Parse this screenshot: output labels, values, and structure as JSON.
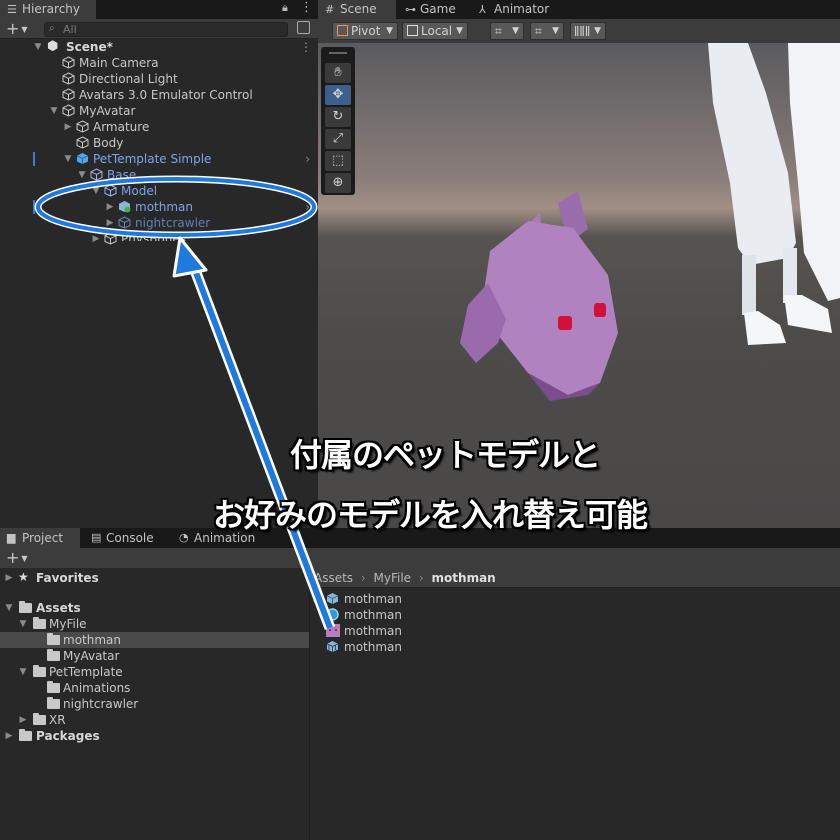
{
  "hierarchy": {
    "tab_label": "Hierarchy",
    "search_placeholder": "All",
    "items": [
      {
        "label": "Scene*"
      },
      {
        "label": "Main Camera"
      },
      {
        "label": "Directional Light"
      },
      {
        "label": "Avatars 3.0 Emulator Control"
      },
      {
        "label": "MyAvatar"
      },
      {
        "label": "Armature"
      },
      {
        "label": "Body"
      },
      {
        "label": "PetTemplate Simple"
      },
      {
        "label": "Base"
      },
      {
        "label": "Model"
      },
      {
        "label": "mothman"
      },
      {
        "label": "nightcrawler"
      },
      {
        "label": "PhysBones"
      }
    ]
  },
  "scene": {
    "tabs": [
      {
        "label": "Scene"
      },
      {
        "label": "Game"
      },
      {
        "label": "Animator"
      }
    ],
    "pivot_label": "Pivot",
    "local_label": "Local",
    "tools": [
      "hand-tool",
      "move-tool",
      "rotate-tool",
      "scale-tool",
      "rect-tool",
      "transform-tool"
    ],
    "active_tool": "move-tool"
  },
  "project": {
    "tabs": [
      {
        "label": "Project"
      },
      {
        "label": "Console"
      },
      {
        "label": "Animation"
      }
    ],
    "tree": [
      {
        "label": "Favorites"
      },
      {
        "label": "Assets"
      },
      {
        "label": "MyFile"
      },
      {
        "label": "mothman"
      },
      {
        "label": "MyAvatar"
      },
      {
        "label": "PetTemplate"
      },
      {
        "label": "Animations"
      },
      {
        "label": "nightcrawler"
      },
      {
        "label": "XR"
      },
      {
        "label": "Packages"
      }
    ],
    "breadcrumb": [
      "Assets",
      "MyFile",
      "mothman"
    ],
    "files": [
      {
        "label": "mothman",
        "icon": "prefab-icon"
      },
      {
        "label": "mothman",
        "icon": "material-icon"
      },
      {
        "label": "mothman",
        "icon": "texture-icon"
      },
      {
        "label": "mothman",
        "icon": "mesh-icon"
      }
    ]
  },
  "annotation": {
    "line1": "付属のペットモデルと",
    "line2": "お好みのモデルを入れ替え可能",
    "accent_color": "#1f7ae0"
  }
}
